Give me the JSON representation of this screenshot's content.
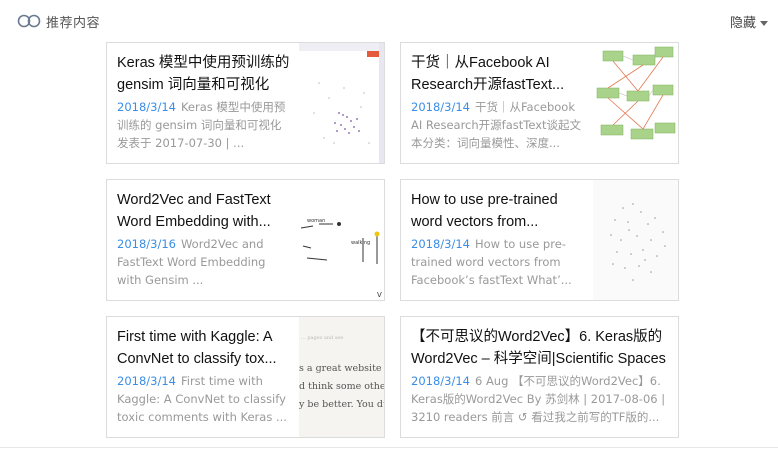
{
  "header": {
    "title": "推荐内容",
    "hide_label": "隐藏"
  },
  "cards": [
    {
      "title": "Keras 模型中使用预训练的 gensim 词向量和可视化",
      "date": "2018/3/14",
      "summary": "Keras 模型中使用预训练的 gensim 词向量和可视化　发表于 2017-07-30 | ..."
    },
    {
      "title": "干货｜从Facebook AI Research开源fastText...",
      "date": "2018/3/14",
      "summary": "干货｜从Facebook AI Research开源fastText谈起文本分类：词向量模性、深度..."
    },
    {
      "title": "Word2Vec and FastText Word Embedding with...",
      "date": "2018/3/16",
      "summary": "Word2Vec and FastText Word Embedding with Gensim ..."
    },
    {
      "title": "How to use pre-trained word vectors from...",
      "date": "2018/3/14",
      "summary": "How to use pre-trained word vectors from Facebook’s fastText What’..."
    },
    {
      "title": "First time with Kaggle: A ConvNet to classify tox...",
      "date": "2018/3/14",
      "summary": "First time with Kaggle: A ConvNet to classify toxic comments with Keras ..."
    },
    {
      "title": "【不可思议的Word2Vec】6. Keras版的Word2Vec – 科学空间|Scientific Spaces",
      "date": "2018/3/14",
      "summary": "6 Aug 【不可思议的Word2Vec】6. Keras版的Word2Vec By 苏剑林 | 2017-08-06 | 3210 readers 前言 ↺ 看过我之前写的TF版的..."
    }
  ],
  "thumb_text": {
    "word_a": "woman",
    "word_b": "walking",
    "v": "V",
    "kaggle_top": "... pages and see",
    "kaggle_l1": "s a great website —",
    "kaggle_l2": "d think some other",
    "kaggle_l3": "y be better. You dun"
  },
  "colors": {
    "accent": "#3a8ee6",
    "border": "#dcdcdc",
    "title": "#111111",
    "summary": "#999999"
  }
}
